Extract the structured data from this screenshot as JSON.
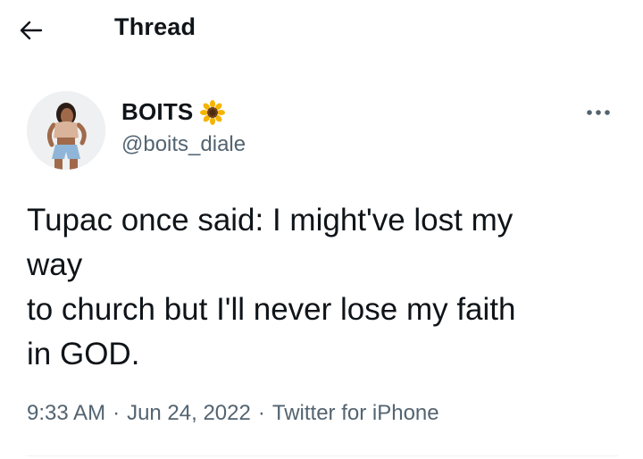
{
  "header": {
    "back_icon": "arrow-left-icon",
    "title": "Thread"
  },
  "author": {
    "avatar_icon": "user-avatar",
    "display_name": "BOITS",
    "name_emoji": "sunflower-icon",
    "handle": "@boits_diale"
  },
  "more_icon": "more-horizontal-icon",
  "tweet": {
    "text": "Tupac once said: I might've lost my\nway\nto church but I'll never lose my faith\nin GOD."
  },
  "meta": {
    "time": "9:33 AM",
    "date": "Jun 24, 2022",
    "source": "Twitter for iPhone",
    "separator": "·"
  },
  "colors": {
    "text_primary": "#0f1419",
    "text_secondary": "#536471",
    "divider": "#eff3f4"
  }
}
